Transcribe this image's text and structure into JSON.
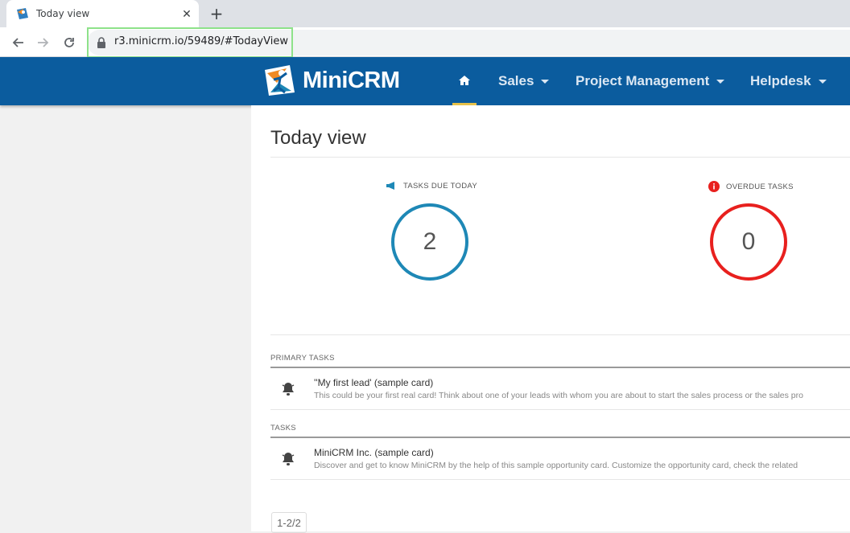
{
  "browser": {
    "tab_title": "Today view",
    "tab_close": "✕",
    "new_tab": "+",
    "url": "r3.minicrm.io/59489/#TodayView"
  },
  "app": {
    "logo_text": "MiniCRM",
    "brand_color": "#0b5c9e",
    "nav": [
      {
        "label": "Sales"
      },
      {
        "label": "Project Management"
      },
      {
        "label": "Helpdesk"
      }
    ]
  },
  "page": {
    "title": "Today view",
    "stats": {
      "due_today_label": "TASKS DUE TODAY",
      "due_today_count": "2",
      "due_today_color": "#1e88b6",
      "overdue_label": "OVERDUE TASKS",
      "overdue_count": "0",
      "overdue_color": "#e8201e"
    },
    "primary_tasks_label": "PRIMARY TASKS",
    "primary_tasks": [
      {
        "title": "''My first lead' (sample card)",
        "description": "This could be your first real card! Think about one of your leads with whom you are about to start the sales process or the sales pro"
      }
    ],
    "tasks_label": "TASKS",
    "tasks": [
      {
        "title": "MiniCRM Inc. (sample card)",
        "description": "Discover and get to know MiniCRM by the help of this sample opportunity card. Customize the opportunity card, check the related"
      }
    ],
    "pager": "1-2/2"
  }
}
